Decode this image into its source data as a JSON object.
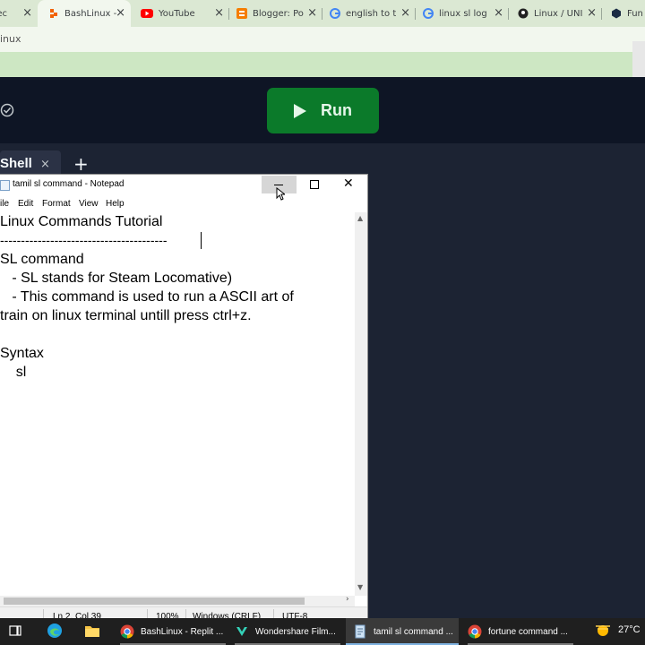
{
  "browser": {
    "tabs": [
      {
        "title": "Tec",
        "favicon": "tech-icon"
      },
      {
        "title": "BashLinux -",
        "favicon": "replit-icon",
        "active": true
      },
      {
        "title": "YouTube",
        "favicon": "youtube-icon"
      },
      {
        "title": "Blogger: Po",
        "favicon": "blogger-icon"
      },
      {
        "title": "english to t",
        "favicon": "google-icon"
      },
      {
        "title": "linux sl log",
        "favicon": "google-icon"
      },
      {
        "title": "Linux / UNI",
        "favicon": "site-icon"
      },
      {
        "title": "Fun",
        "favicon": "site-icon"
      }
    ],
    "address_fragment": "inux"
  },
  "replit": {
    "run_label": "Run",
    "shell_tab_label": "Shell",
    "new_tab_symbol": "+",
    "close_symbol": "×"
  },
  "notepad": {
    "title": "tamil sl command - Notepad",
    "menu": [
      "ile",
      "Edit",
      "Format",
      "View",
      "Help"
    ],
    "lines": [
      "Linux Commands Tutorial",
      "----------------------------------------",
      "SL command",
      "   - SL stands for Steam Locomative)",
      "   - This command is used to run a ASCII art of",
      "train on linux terminal untill press ctrl+z.",
      "",
      "Syntax",
      "    sl"
    ],
    "status": {
      "position": "Ln 2, Col 39",
      "zoom": "100%",
      "line_ending": "Windows (CRLF)",
      "encoding": "UTF-8"
    }
  },
  "taskbar": {
    "items": [
      {
        "label": "",
        "icon": "task-view-icon"
      },
      {
        "label": "",
        "icon": "edge-icon"
      },
      {
        "label": "",
        "icon": "file-explorer-icon"
      },
      {
        "label": "BashLinux - Replit ...",
        "icon": "chrome-icon"
      },
      {
        "label": "Wondershare Film...",
        "icon": "filmora-icon"
      },
      {
        "label": "tamil sl command ...",
        "icon": "notepad-icon",
        "active": true
      },
      {
        "label": "fortune command ...",
        "icon": "chrome-icon"
      }
    ],
    "temperature": "27°C"
  },
  "colors": {
    "run_button": "#0b7a2a",
    "replit_bg": "#0e1525",
    "tabstrip": "#dbe8d3",
    "taskbar": "#1f1f1f"
  }
}
